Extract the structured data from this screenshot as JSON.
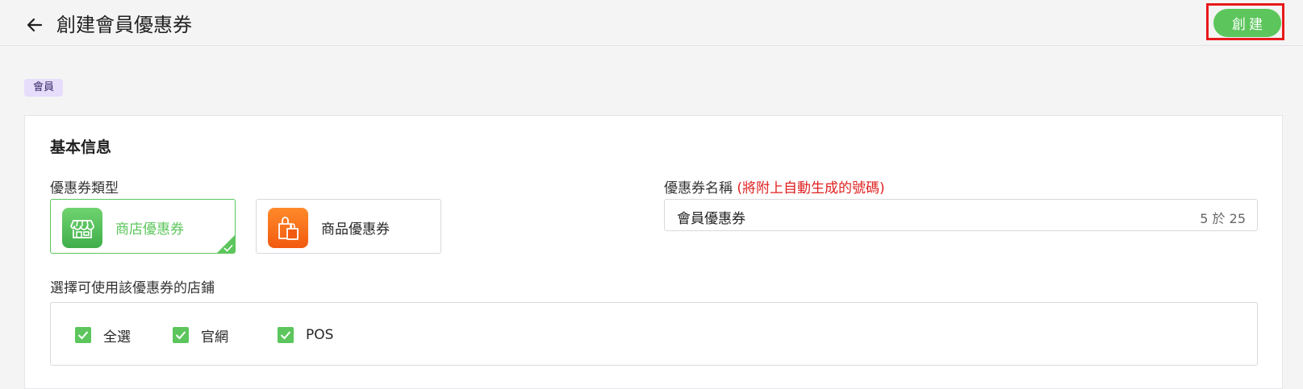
{
  "header": {
    "back_icon": "arrow-left-icon",
    "title": "創建會員優惠券",
    "create_label": "創建"
  },
  "member_tag": "會員",
  "basic_info": {
    "section_title": "基本信息",
    "coupon_type_label": "優惠券類型",
    "coupon_types": [
      {
        "label": "商店優惠券",
        "icon": "storefront-icon",
        "selected": true
      },
      {
        "label": "商品優惠券",
        "icon": "shopping-bag-icon",
        "selected": false
      }
    ],
    "coupon_name_label": "優惠券名稱",
    "coupon_name_note": "(將附上自動生成的號碼)",
    "coupon_name_value": "會員優惠券",
    "coupon_name_counter": "5 於 25",
    "stores_label": "選擇可使用該優惠券的店鋪",
    "stores": [
      {
        "label": "全選",
        "checked": true
      },
      {
        "label": "官網",
        "checked": true
      },
      {
        "label": "POS",
        "checked": true
      }
    ]
  },
  "colors": {
    "accent_green": "#5cc65c",
    "highlight_red": "#e8191a",
    "note_red": "#e02020",
    "tag_purple": "#e6ddfb",
    "product_orange": "#f25a10"
  }
}
